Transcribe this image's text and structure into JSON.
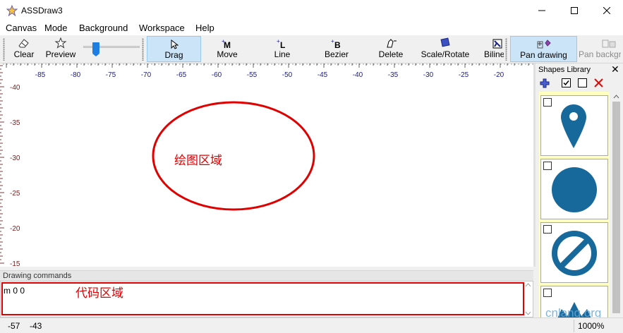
{
  "window": {
    "title": "ASSDraw3"
  },
  "menu": [
    "Canvas",
    "Mode",
    "Background",
    "Workspace",
    "Help"
  ],
  "toolbar": {
    "clear": "Clear",
    "preview": "Preview",
    "drag": "Drag",
    "move": "Move",
    "line": "Line",
    "bezier": "Bezier",
    "delete": "Delete",
    "scale_rotate": "Scale/Rotate",
    "bilinear": "Biline",
    "pan_drawing": "Pan drawing",
    "pan_background": "Pan backgr"
  },
  "ruler": {
    "x_ticks": [
      "-85",
      "-80",
      "-75",
      "-70",
      "-65",
      "-60",
      "-55",
      "-50",
      "-45",
      "-40",
      "-35",
      "-30",
      "-25",
      "-20"
    ],
    "y_ticks": [
      "-40",
      "-35",
      "-30",
      "-25",
      "-20",
      "-15"
    ]
  },
  "canvas": {
    "annotation": "绘图区域"
  },
  "commands": {
    "title": "Drawing commands",
    "value": "m 0 0",
    "annotation": "代码区域"
  },
  "library": {
    "title": "Shapes Library"
  },
  "status": {
    "x": "-57",
    "y": "-43",
    "zoom": "1000%"
  },
  "watermark": "cnlang.org",
  "colors": {
    "shape_blue": "#17699c",
    "annotation_red": "#e00000",
    "library_bg": "#ffffc0",
    "ruler_text": "#1b1b8a"
  }
}
